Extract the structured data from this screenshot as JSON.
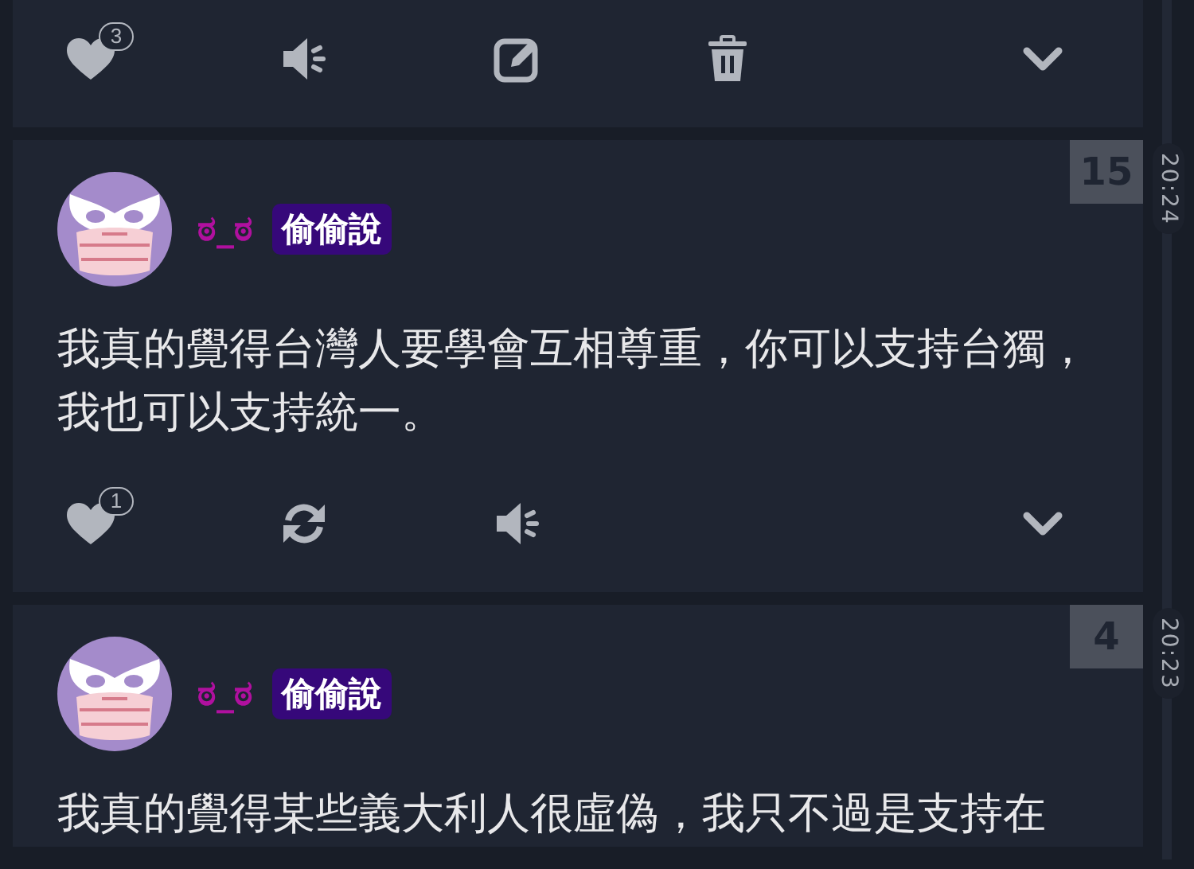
{
  "posts": [
    {
      "actions": [
        {
          "kind": "like",
          "count": "3"
        },
        {
          "kind": "speaker"
        },
        {
          "kind": "edit"
        },
        {
          "kind": "delete"
        },
        {
          "kind": "expand"
        }
      ]
    },
    {
      "rank": "15",
      "time": "20:24",
      "author": "ಠ_ಠ",
      "tag": "偷偷說",
      "text": "我真的覺得台灣人要學會互相尊重，你可以支持台獨，我也可以支持統一。",
      "actions": [
        {
          "kind": "like",
          "count": "1"
        },
        {
          "kind": "refresh"
        },
        {
          "kind": "speaker"
        },
        {
          "kind": "expand"
        }
      ]
    },
    {
      "rank": "4",
      "time": "20:23",
      "author": "ಠ_ಠ",
      "tag": "偷偷說",
      "text": "我真的覺得某些義大利人很虛偽，我只不過是支持在"
    }
  ]
}
